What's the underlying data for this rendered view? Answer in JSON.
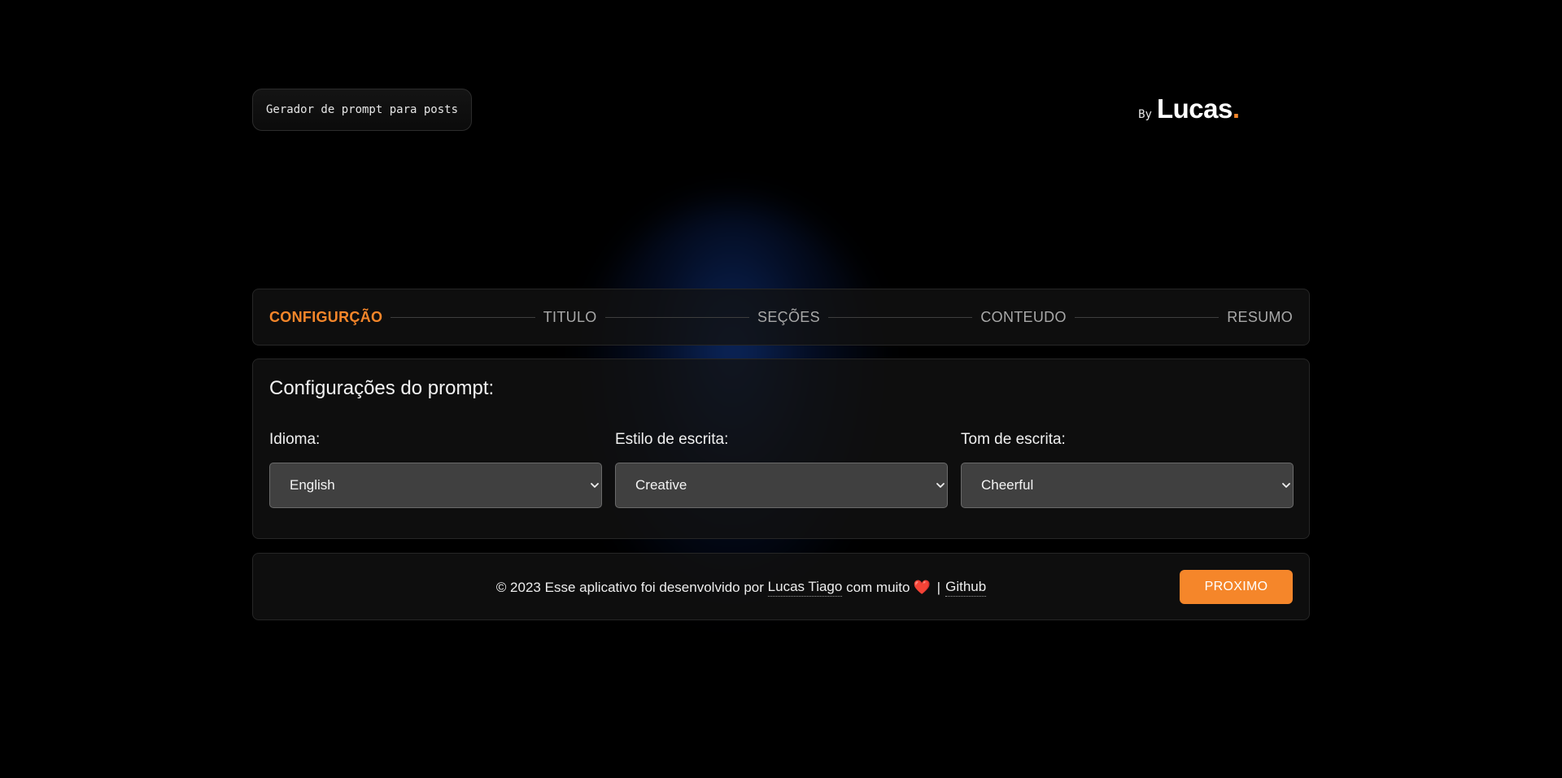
{
  "header": {
    "app_title": "Gerador de prompt para posts",
    "brand_prefix": "By",
    "brand_name": "Lucas",
    "brand_dot": "."
  },
  "stepper": {
    "steps": [
      {
        "label": "CONFIGURÇÃO",
        "active": true
      },
      {
        "label": "TITULO",
        "active": false
      },
      {
        "label": "SEÇÕES",
        "active": false
      },
      {
        "label": "CONTEUDO",
        "active": false
      },
      {
        "label": "RESUMO",
        "active": false
      }
    ]
  },
  "config": {
    "title": "Configurações do prompt:",
    "fields": [
      {
        "label": "Idioma:",
        "value": "English"
      },
      {
        "label": "Estilo de escrita:",
        "value": "Creative"
      },
      {
        "label": "Tom de escrita:",
        "value": "Cheerful"
      }
    ]
  },
  "footer": {
    "text_before": "© 2023 Esse aplicativo foi desenvolvido por",
    "author_link": "Lucas Tiago",
    "text_middle": "com muito",
    "heart": "❤️",
    "separator": "|",
    "github_link": "Github",
    "next_label": "PROXIMO"
  },
  "colors": {
    "accent": "#f5862a",
    "background": "#000000",
    "card": "#121212",
    "select_bg": "#404040",
    "glow": "#1446aa"
  },
  "icons": {
    "select_chevron": "chevron-down-icon",
    "footer_heart": "heart-icon"
  }
}
